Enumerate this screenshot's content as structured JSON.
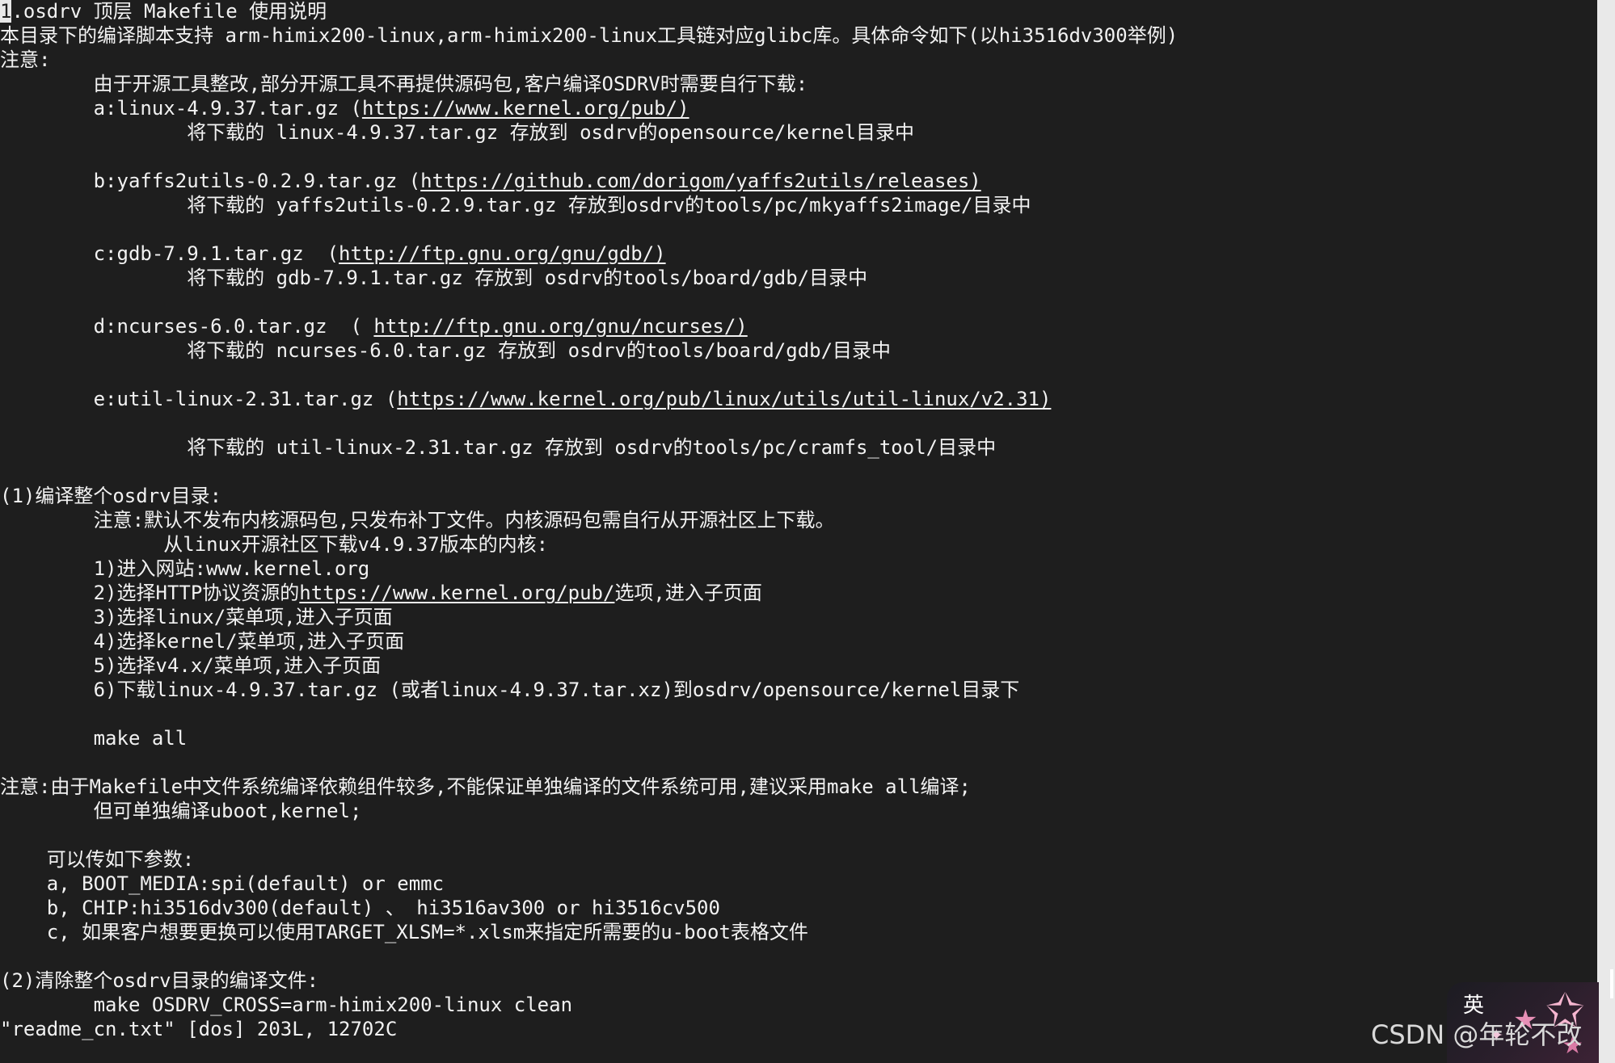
{
  "terminal": {
    "cursor_char": "1",
    "line_01_rest": ".osdrv 顶层 Makefile 使用说明",
    "line_02": "本目录下的编译脚本支持 arm-himix200-linux,arm-himix200-linux工具链对应glibc库。具体命令如下(以hi3516dv300举例)",
    "line_03": "注意:",
    "line_04": "        由于开源工具整改,部分开源工具不再提供源码包,客户编译OSDRV时需要自行下载:",
    "line_05_pre": "        a:linux-4.9.37.tar.gz (",
    "line_05_link": "https://www.kernel.org/pub/)",
    "line_06": "                将下载的 linux-4.9.37.tar.gz 存放到 osdrv的opensource/kernel目录中",
    "line_08_pre": "        b:yaffs2utils-0.2.9.tar.gz (",
    "line_08_link": "https://github.com/dorigom/yaffs2utils/releases)",
    "line_09": "                将下载的 yaffs2utils-0.2.9.tar.gz 存放到osdrv的tools/pc/mkyaffs2image/目录中",
    "line_11_pre": "        c:gdb-7.9.1.tar.gz  (",
    "line_11_link": "http://ftp.gnu.org/gnu/gdb/)",
    "line_12": "                将下载的 gdb-7.9.1.tar.gz 存放到 osdrv的tools/board/gdb/目录中",
    "line_14_pre": "        d:ncurses-6.0.tar.gz  ( ",
    "line_14_link": "http://ftp.gnu.org/gnu/ncurses/)",
    "line_15": "                将下载的 ncurses-6.0.tar.gz 存放到 osdrv的tools/board/gdb/目录中",
    "line_17_pre": "        e:util-linux-2.31.tar.gz (",
    "line_17_link": "https://www.kernel.org/pub/linux/utils/util-linux/v2.31)",
    "line_19": "                将下载的 util-linux-2.31.tar.gz 存放到 osdrv的tools/pc/cramfs_tool/目录中",
    "line_21": "(1)编译整个osdrv目录:",
    "line_22": "        注意:默认不发布内核源码包,只发布补丁文件。内核源码包需自行从开源社区上下载。",
    "line_23": "              从linux开源社区下载v4.9.37版本的内核:",
    "line_24": "        1)进入网站:www.kernel.org",
    "line_25_pre": "        2)选择HTTP协议资源的",
    "line_25_link": "https://www.kernel.org/pub/",
    "line_25_post": "选项,进入子页面",
    "line_26": "        3)选择linux/菜单项,进入子页面",
    "line_27": "        4)选择kernel/菜单项,进入子页面",
    "line_28": "        5)选择v4.x/菜单项,进入子页面",
    "line_29": "        6)下载linux-4.9.37.tar.gz (或者linux-4.9.37.tar.xz)到osdrv/opensource/kernel目录下",
    "line_31": "        make all",
    "line_33": "注意:由于Makefile中文件系统编译依赖组件较多,不能保证单独编译的文件系统可用,建议采用make all编译;",
    "line_34": "        但可单独编译uboot,kernel;",
    "line_36": "    可以传如下参数:",
    "line_37": "    a, BOOT_MEDIA:spi(default) or emmc",
    "line_38": "    b, CHIP:hi3516dv300(default) 、 hi3516av300 or hi3516cv500",
    "line_39": "    c, 如果客户想要更换可以使用TARGET_XLSM=*.xlsm来指定所需要的u-boot表格文件",
    "line_41": "(2)清除整个osdrv目录的编译文件:",
    "line_42": "        make OSDRV_CROSS=arm-himix200-linux clean",
    "status_line": "\"readme_cn.txt\" [dos] 203L, 12702C"
  },
  "ime_badge": {
    "char": "英"
  },
  "watermark": {
    "text": "CSDN @年轮不改"
  },
  "colors": {
    "background": "#1e1e1e",
    "text": "#f2f2f2",
    "scrollbar": "#e9e9e9"
  }
}
